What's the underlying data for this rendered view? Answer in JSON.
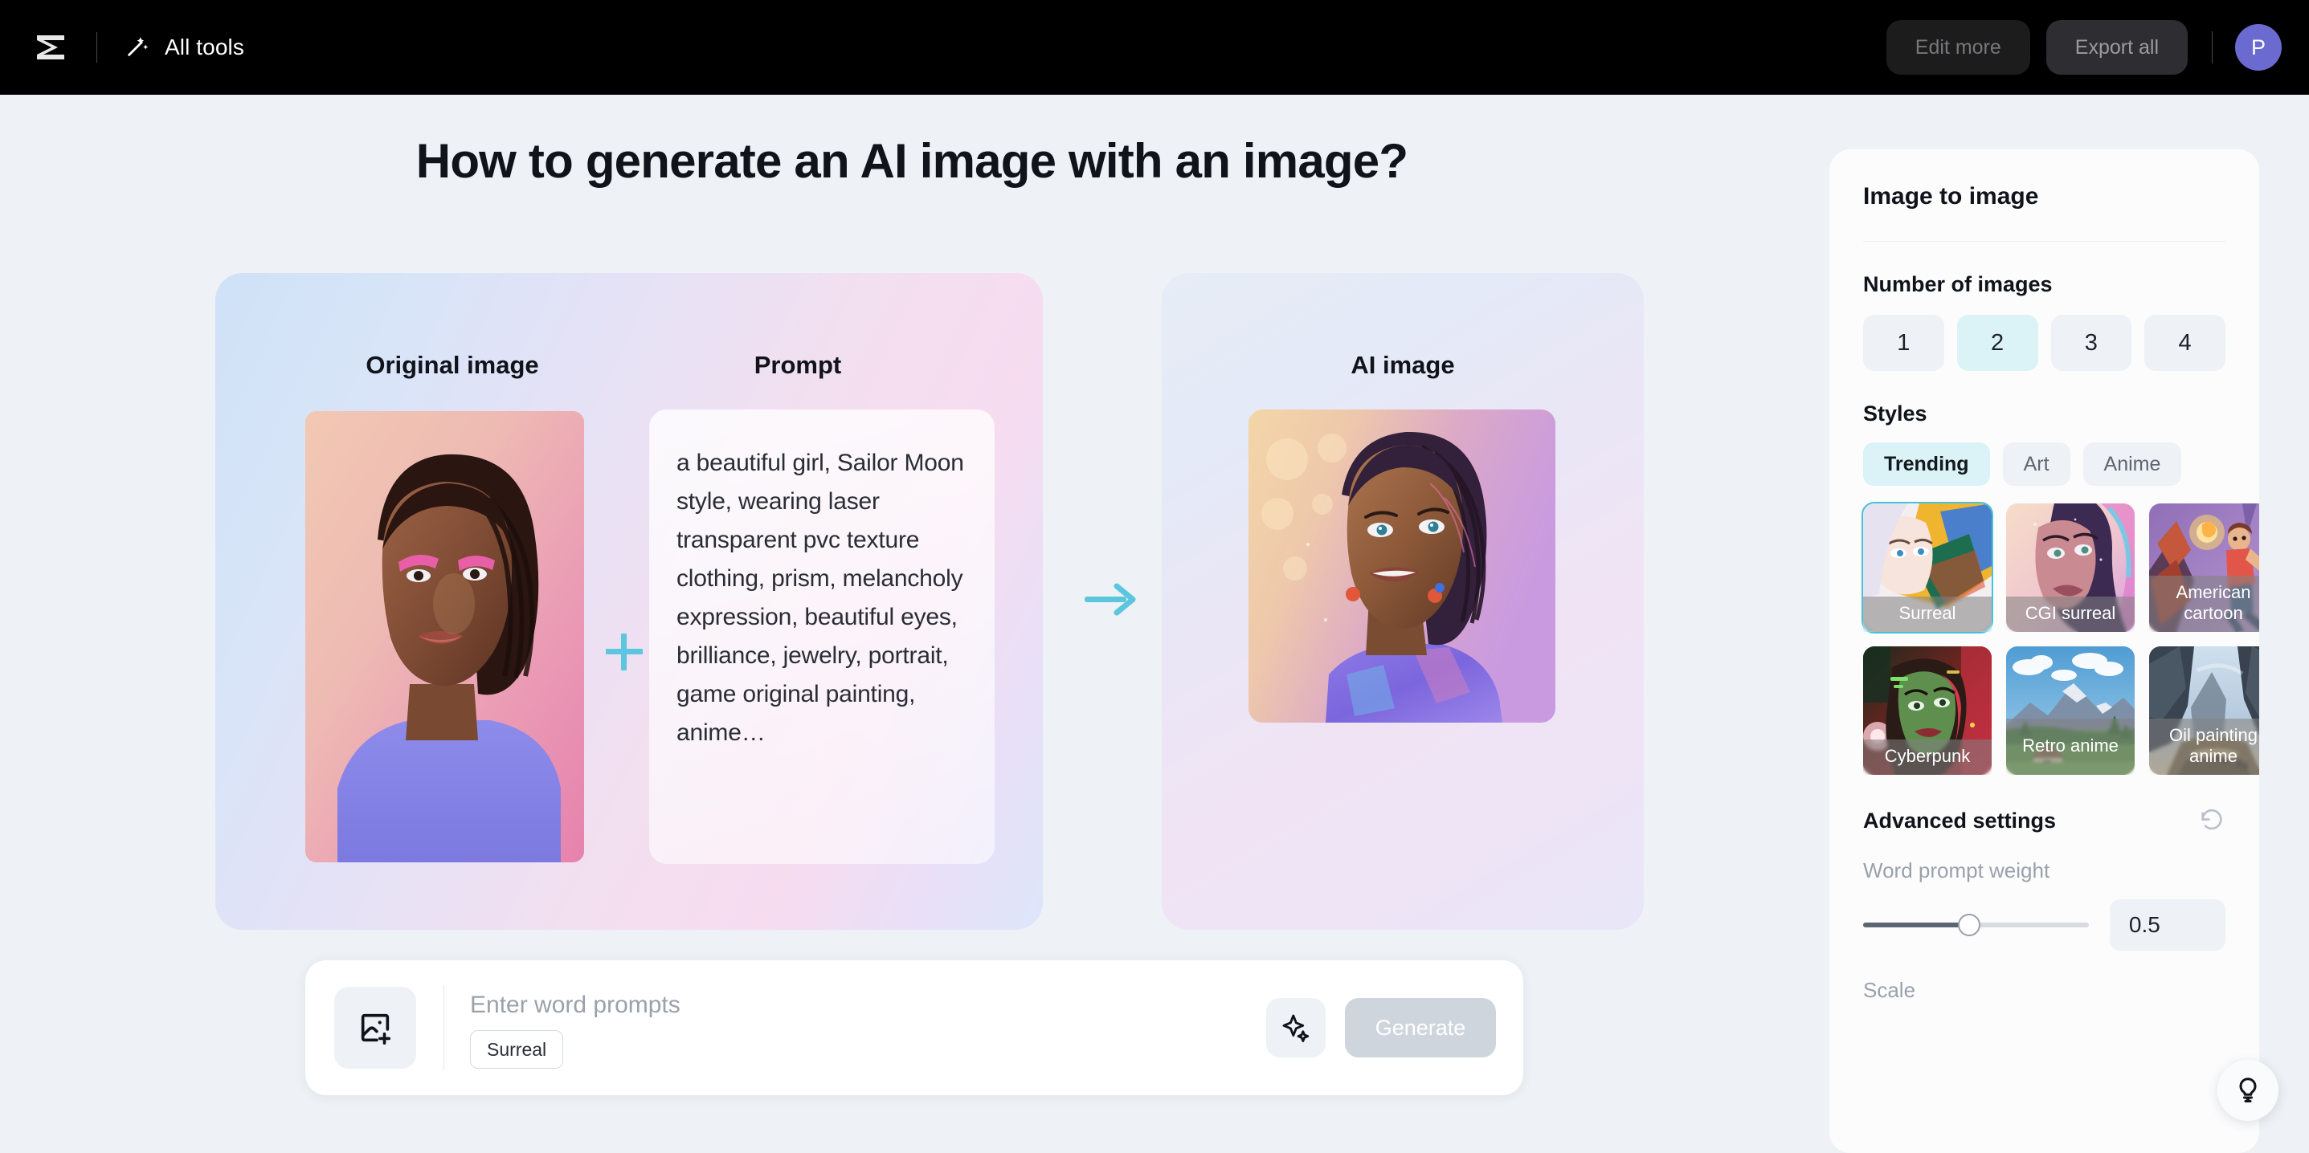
{
  "topbar": {
    "logo_icon": "capcut-logo-icon",
    "all_tools_icon": "magic-wand-icon",
    "all_tools_label": "All tools",
    "edit_more_label": "Edit more",
    "export_all_label": "Export all",
    "avatar_initial": "P",
    "avatar_color": "#6a6ad0"
  },
  "page": {
    "title": "How to generate an AI image with an image?"
  },
  "showcase": {
    "original_heading": "Original image",
    "prompt_heading": "Prompt",
    "ai_heading": "AI image",
    "plus_icon": "plus-icon",
    "arrow_icon": "arrow-right-icon",
    "accent_color": "#5bc6dd",
    "prompt_text": "a beautiful girl, Sailor Moon style, wearing laser transparent pvc texture clothing, prism, melancholy expression, beautiful eyes, brilliance, jewelry, portrait, game original painting, anime…"
  },
  "inputbar": {
    "add_image_icon": "add-image-icon",
    "placeholder": "Enter word prompts",
    "value": "",
    "style_chip": "Surreal",
    "sparkle_icon": "sparkle-icon",
    "generate_label": "Generate",
    "generate_disabled": true
  },
  "panel": {
    "title": "Image to image",
    "number_of_images": {
      "label": "Number of images",
      "options": [
        "1",
        "2",
        "3",
        "4"
      ],
      "selected": "2"
    },
    "styles": {
      "label": "Styles",
      "tabs": [
        "Trending",
        "Art",
        "Anime"
      ],
      "selected_tab": "Trending",
      "items": [
        {
          "label": "Surreal",
          "selected": true
        },
        {
          "label": "CGI surreal",
          "selected": false
        },
        {
          "label": "American cartoon",
          "selected": false
        },
        {
          "label": "Cyberpunk",
          "selected": false
        },
        {
          "label": "Retro anime",
          "selected": false
        },
        {
          "label": "Oil painting anime",
          "selected": false
        }
      ],
      "selected_style": "Surreal",
      "selection_color": "#46c3da"
    },
    "advanced": {
      "title": "Advanced settings",
      "reset_icon": "reset-icon",
      "word_prompt_weight_label": "Word prompt weight",
      "word_prompt_weight_value": "0.5",
      "word_prompt_weight_percent": 47,
      "scale_label": "Scale"
    }
  },
  "help_fab": {
    "icon": "lightbulb-icon"
  }
}
